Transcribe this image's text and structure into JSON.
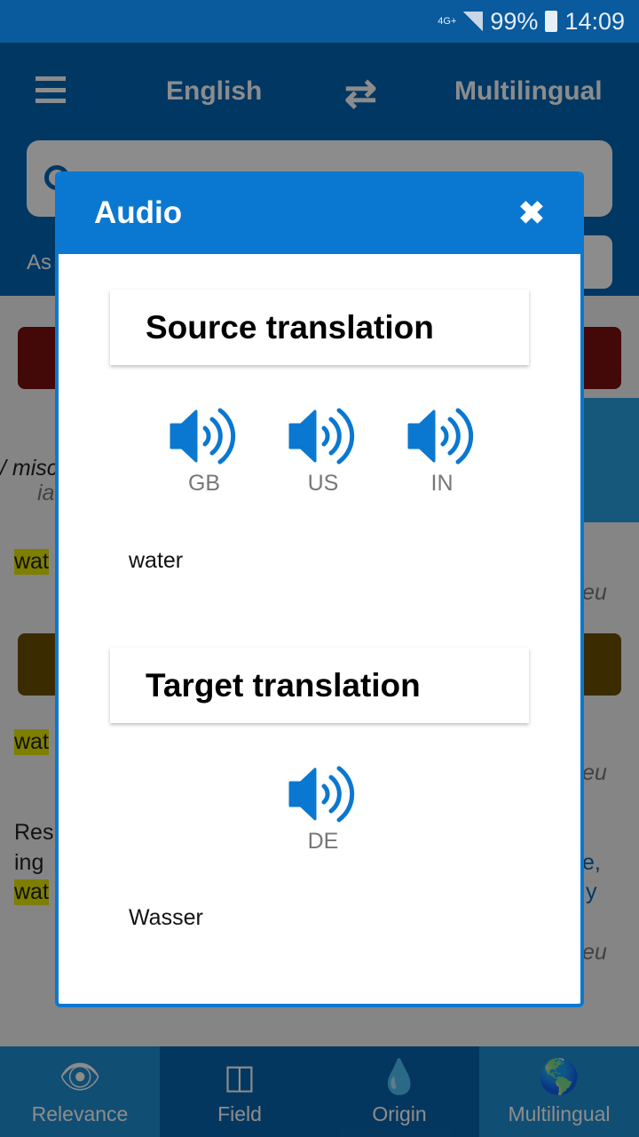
{
  "status_bar": {
    "network": "4G+",
    "battery": "99%",
    "time": "14:09"
  },
  "header": {
    "source_language": "English",
    "target_language": "Multilingual",
    "swap_icon": "swap-arrows-icon",
    "menu_icon": "hamburger-icon"
  },
  "search": {
    "subbar_fragment": "As"
  },
  "background_fragments": {
    "misc": "/ misc",
    "ia": "ia",
    "wat1": "wat",
    "eu1": "eu",
    "wat2": "wat",
    "eu2": "eu",
    "res": "Res",
    "ing": "ing",
    "wat3": "wat",
    "e": "e,",
    "y": "y",
    "eu3": "eu"
  },
  "dialog": {
    "title": "Audio",
    "close_icon": "close-icon",
    "source": {
      "heading": "Source translation",
      "accents": [
        "GB",
        "US",
        "IN"
      ],
      "word": "water"
    },
    "target": {
      "heading": "Target translation",
      "accents": [
        "DE"
      ],
      "word": "Wasser"
    },
    "accent_color": "#0a78d0"
  },
  "bottom_nav": [
    {
      "label": "Relevance",
      "icon": "eye-icon"
    },
    {
      "label": "Field",
      "icon": "columns-icon"
    },
    {
      "label": "Origin",
      "icon": "drop-icon"
    },
    {
      "label": "Multilingual",
      "icon": "globe-icon"
    }
  ]
}
